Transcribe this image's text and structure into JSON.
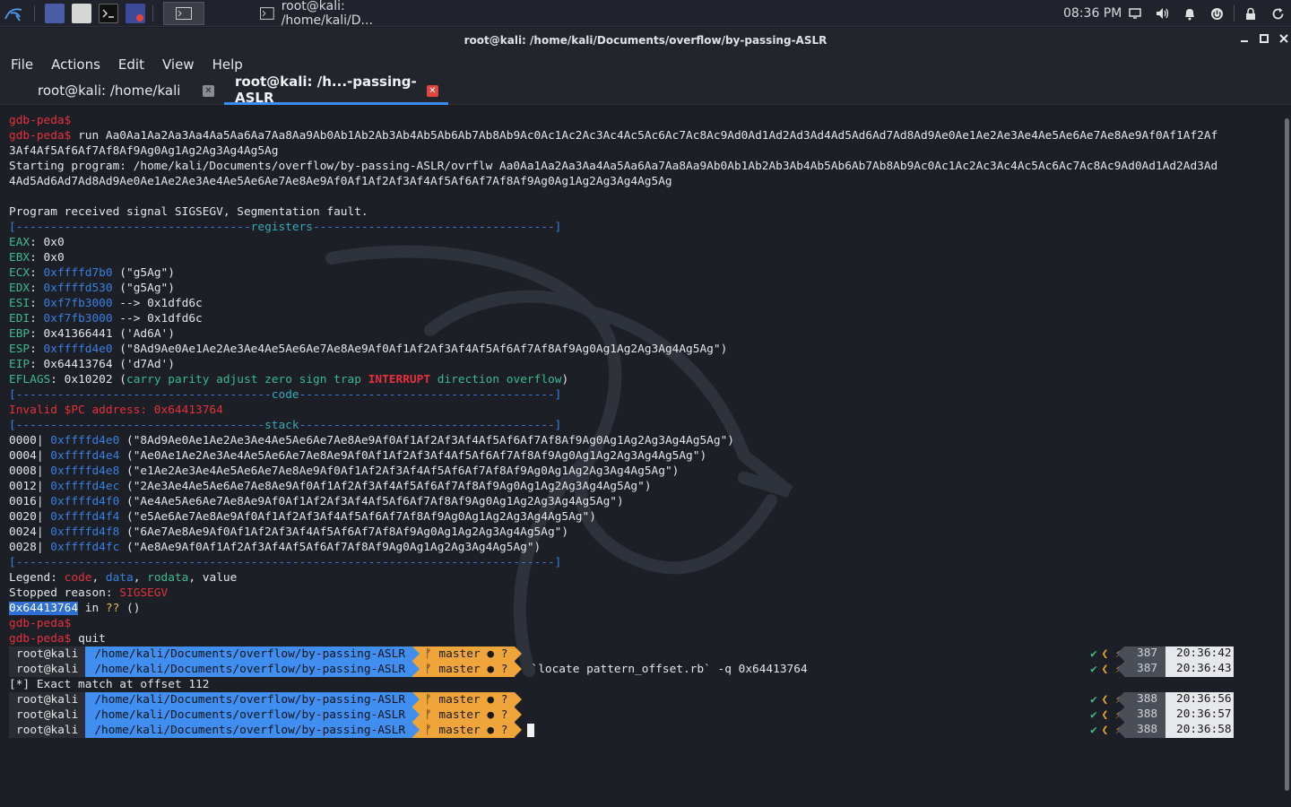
{
  "taskbar": {
    "window_title": "root@kali: /home/kali/D...",
    "clock": "08:36 PM"
  },
  "window": {
    "title": "root@kali: /home/kali/Documents/overflow/by-passing-ASLR"
  },
  "menu": [
    "File",
    "Actions",
    "Edit",
    "View",
    "Help"
  ],
  "tabs": [
    {
      "label": "root@kali: /home/kali"
    },
    {
      "label": "root@kali: /h...-passing-ASLR"
    }
  ],
  "terminal": {
    "prompt": "gdb-peda$",
    "run_cmd": "run Aa0Aa1Aa2Aa3Aa4Aa5Aa6Aa7Aa8Aa9Ab0Ab1Ab2Ab3Ab4Ab5Ab6Ab7Ab8Ab9Ac0Ac1Ac2Ac3Ac4Ac5Ac6Ac7Ac8Ac9Ad0Ad1Ad2Ad3Ad4Ad5Ad6Ad7Ad8Ad9Ae0Ae1Ae2Ae3Ae4Ae5Ae6Ae7Ae8Ae9Af0Af1Af2Af",
    "run_cmd_wrap": "3Af4Af5Af6Af7Af8Af9Ag0Ag1Ag2Ag3Ag4Ag5Ag",
    "starting": "Starting program: /home/kali/Documents/overflow/by-passing-ASLR/ovrflw Aa0Aa1Aa2Aa3Aa4Aa5Aa6Aa7Aa8Aa9Ab0Ab1Ab2Ab3Ab4Ab5Ab6Ab7Ab8Ab9Ac0Ac1Ac2Ac3Ac4Ac5Ac6Ac7Ac8Ac9Ad0Ad1Ad2Ad3Ad",
    "starting_wrap": "4Ad5Ad6Ad7Ad8Ad9Ae0Ae1Ae2Ae3Ae4Ae5Ae6Ae7Ae8Ae9Af0Af1Af2Af3Af4Af5Af6Af7Af8Af9Ag0Ag1Ag2Ag3Ag4Ag5Ag",
    "signal": "Program received signal SIGSEGV, Segmentation fault.",
    "sep_registers": [
      "[----------------------------------",
      "registers",
      "-----------------------------------]"
    ],
    "registers": [
      {
        "name": "EAX",
        "addr": "",
        "rest": "0x0"
      },
      {
        "name": "EBX",
        "addr": "",
        "rest": "0x0"
      },
      {
        "name": "ECX",
        "addr": "0xffffd7b0",
        "rest": " (\"g5Ag\")"
      },
      {
        "name": "EDX",
        "addr": "0xffffd530",
        "rest": " (\"g5Ag\")"
      },
      {
        "name": "ESI",
        "addr": "0xf7fb3000",
        "rest": " --> 0x1dfd6c"
      },
      {
        "name": "EDI",
        "addr": "0xf7fb3000",
        "rest": " --> 0x1dfd6c"
      },
      {
        "name": "EBP",
        "addr": "",
        "rest": "0x41366441 ('Ad6A')"
      },
      {
        "name": "ESP",
        "addr": "0xffffd4e0",
        "rest": " (\"8Ad9Ae0Ae1Ae2Ae3Ae4Ae5Ae6Ae7Ae8Ae9Af0Af1Af2Af3Af4Af5Af6Af7Af8Af9Ag0Ag1Ag2Ag3Ag4Ag5Ag\")"
      },
      {
        "name": "EIP",
        "addr": "",
        "rest": "0x64413764 ('d7Ad')"
      }
    ],
    "eflags": {
      "label": "EFLAGS",
      "value": "0x10202",
      "flags_a": "carry parity adjust zero sign trap",
      "flag_int": "INTERRUPT",
      "flags_b": "direction overflow"
    },
    "sep_code": [
      "[-------------------------------------",
      "code",
      "-------------------------------------]"
    ],
    "invalid_pc": "Invalid $PC address: 0x64413764",
    "sep_stack": [
      "[------------------------------------",
      "stack",
      "-------------------------------------]"
    ],
    "stack": [
      {
        "off": "0000|",
        "addr": "0xffffd4e0",
        "val": " (\"8Ad9Ae0Ae1Ae2Ae3Ae4Ae5Ae6Ae7Ae8Ae9Af0Af1Af2Af3Af4Af5Af6Af7Af8Af9Ag0Ag1Ag2Ag3Ag4Ag5Ag\")"
      },
      {
        "off": "0004|",
        "addr": "0xffffd4e4",
        "val": " (\"Ae0Ae1Ae2Ae3Ae4Ae5Ae6Ae7Ae8Ae9Af0Af1Af2Af3Af4Af5Af6Af7Af8Af9Ag0Ag1Ag2Ag3Ag4Ag5Ag\")"
      },
      {
        "off": "0008|",
        "addr": "0xffffd4e8",
        "val": " (\"e1Ae2Ae3Ae4Ae5Ae6Ae7Ae8Ae9Af0Af1Af2Af3Af4Af5Af6Af7Af8Af9Ag0Ag1Ag2Ag3Ag4Ag5Ag\")"
      },
      {
        "off": "0012|",
        "addr": "0xffffd4ec",
        "val": " (\"2Ae3Ae4Ae5Ae6Ae7Ae8Ae9Af0Af1Af2Af3Af4Af5Af6Af7Af8Af9Ag0Ag1Ag2Ag3Ag4Ag5Ag\")"
      },
      {
        "off": "0016|",
        "addr": "0xffffd4f0",
        "val": " (\"Ae4Ae5Ae6Ae7Ae8Ae9Af0Af1Af2Af3Af4Af5Af6Af7Af8Af9Ag0Ag1Ag2Ag3Ag4Ag5Ag\")"
      },
      {
        "off": "0020|",
        "addr": "0xffffd4f4",
        "val": " (\"e5Ae6Ae7Ae8Ae9Af0Af1Af2Af3Af4Af5Af6Af7Af8Af9Ag0Ag1Ag2Ag3Ag4Ag5Ag\")"
      },
      {
        "off": "0024|",
        "addr": "0xffffd4f8",
        "val": " (\"6Ae7Ae8Ae9Af0Af1Af2Af3Af4Af5Af6Af7Af8Af9Ag0Ag1Ag2Ag3Ag4Ag5Ag\")"
      },
      {
        "off": "0028|",
        "addr": "0xffffd4fc",
        "val": " (\"Ae8Ae9Af0Af1Af2Af3Af4Af5Af6Af7Af8Af9Ag0Ag1Ag2Ag3Ag4Ag5Ag\")"
      }
    ],
    "sep_end": "[------------------------------------------------------------------------------]",
    "legend": {
      "label": "Legend: ",
      "code": "code",
      "data": "data",
      "rodata": "rodata",
      "value": "value"
    },
    "stopped": {
      "label": "Stopped reason: ",
      "reason": "SIGSEGV"
    },
    "frame": {
      "addr": "0x64413764",
      "in": " in ",
      "fn": "??",
      "args": " ()"
    },
    "quit_cmd": "quit",
    "exact_match": "[*] Exact match at offset 112"
  },
  "shell_prompts": [
    {
      "user": "root@kali",
      "path": "/home/kali/Documents/overflow/by-passing-ASLR",
      "git": "ᚠ master ● ?",
      "cmd": "",
      "hist": "387",
      "time": "20:36:42"
    },
    {
      "user": "root@kali",
      "path": "/home/kali/Documents/overflow/by-passing-ASLR",
      "git": "ᚠ master ● ?",
      "cmd": "`locate pattern_offset.rb` -q 0x64413764",
      "hist": "387",
      "time": "20:36:43"
    },
    {
      "user": "root@kali",
      "path": "/home/kali/Documents/overflow/by-passing-ASLR",
      "git": "ᚠ master ● ?",
      "cmd": "",
      "hist": "388",
      "time": "20:36:56"
    },
    {
      "user": "root@kali",
      "path": "/home/kali/Documents/overflow/by-passing-ASLR",
      "git": "ᚠ master ● ?",
      "cmd": "",
      "hist": "388",
      "time": "20:36:57"
    },
    {
      "user": "root@kali",
      "path": "/home/kali/Documents/overflow/by-passing-ASLR",
      "git": "ᚠ master ● ?",
      "cmd": "",
      "hist": "388",
      "time": "20:36:58"
    }
  ],
  "right_prompt": {
    "ok": "✔",
    "sym": "❮ ⚡"
  },
  "icons": {
    "kali": "kali-dragon-icon",
    "desktop": "show-desktop-icon",
    "files": "file-manager-icon",
    "terminal": "terminal-icon",
    "recorder": "screen-recorder-icon",
    "tray": [
      "display-icon",
      "volume-icon",
      "bell-icon",
      "power-icon",
      "lock-icon",
      "refresh-icon"
    ]
  },
  "colors": {
    "accent": "#3c8bef",
    "red": "#e5313d",
    "blue": "#3a7fe0",
    "green": "#3dbb8c",
    "orange": "#f0a53a"
  }
}
